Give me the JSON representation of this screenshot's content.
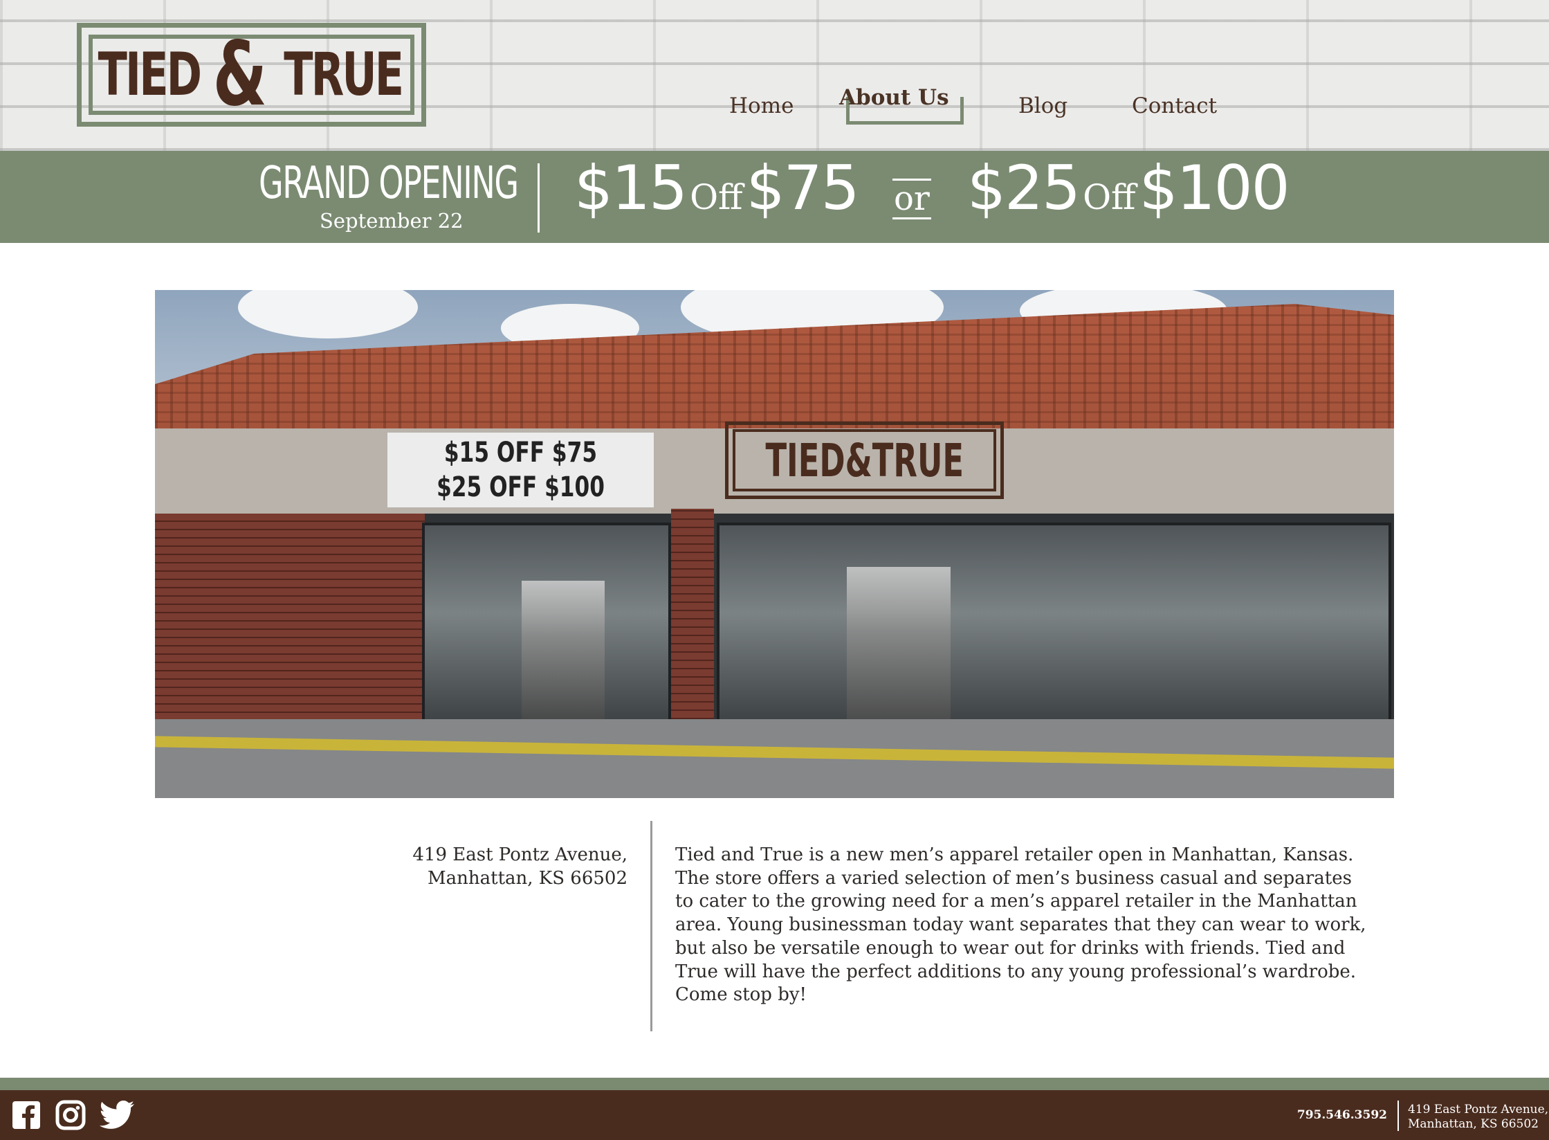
{
  "brand": {
    "logo_text_left": "TIED",
    "logo_amp": "&",
    "logo_text_right": "TRUE",
    "colors": {
      "sage": "#7b8b72",
      "brown": "#4a2c1e",
      "white": "#ffffff"
    }
  },
  "nav": {
    "items": [
      {
        "label": "Home"
      },
      {
        "label": "About Us",
        "active": true
      },
      {
        "label": "Blog"
      },
      {
        "label": "Contact"
      }
    ]
  },
  "banner": {
    "title": "GRAND OPENING",
    "date": "September 22",
    "offer1": {
      "amount": "$15",
      "off": "Off",
      "threshold": "$75"
    },
    "connector": "or",
    "offer2": {
      "amount": "$25",
      "off": "Off",
      "threshold": "$100"
    }
  },
  "photo": {
    "sign_line1": "$15 OFF $75",
    "sign_line2": "$25 OFF $100",
    "sign_logo": "TIED&TRUE"
  },
  "about": {
    "address_line1": "419 East Pontz Avenue,",
    "address_line2": "Manhattan, KS 66502",
    "description": "Tied and True is a new men’s apparel retailer open in Manhattan, Kansas. The store offers a varied selection of men’s business casual and separates to cater to the growing need for a men’s apparel retailer in the Manhattan area. Young businessman today want separates that they can wear to work, but also be versatile enough to wear out for drinks with friends. Tied and True will have the perfect additions to any young professional’s wardrobe. Come stop by!"
  },
  "footer": {
    "social_icons": [
      "facebook-icon",
      "instagram-icon",
      "twitter-icon"
    ],
    "phone": "795.546.3592",
    "address_line1": "419 East Pontz Avenue,",
    "address_line2": "Manhattan, KS 66502"
  }
}
